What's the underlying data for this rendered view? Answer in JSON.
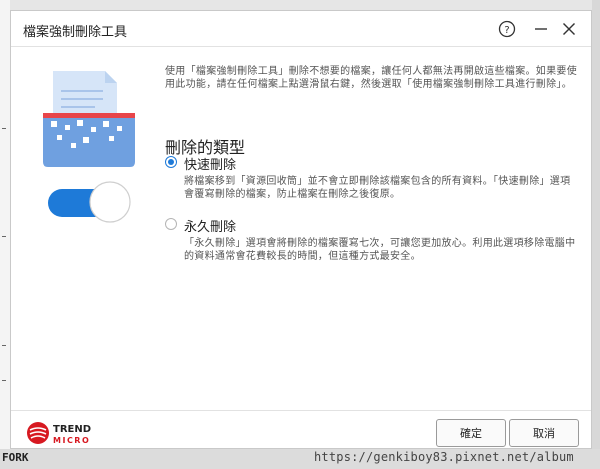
{
  "dialog": {
    "title": "檔案強制刪除工具",
    "help_icon": "help-circle-icon",
    "minimize_icon": "minimize-icon",
    "close_icon": "close-icon"
  },
  "intro_text": "使用「檔案強制刪除工具」刪除不想要的檔案，讓任何人都無法再開啟這些檔案。如果要使用此功能，請在任何檔案上點選滑鼠右鍵，然後選取「使用檔案強制刪除工具進行刪除」。",
  "deletion_types": {
    "title": "刪除的類型",
    "options": [
      {
        "label": "快速刪除",
        "description": "將檔案移到「資源回收筒」並不會立即刪除該檔案包含的所有資料。「快速刪除」選項會覆寫刪除的檔案，防止檔案在刪除之後復原。",
        "selected": true
      },
      {
        "label": "永久刪除",
        "description": "「永久刪除」選項會將刪除的檔案覆寫七次，可讓您更加放心。利用此選項移除電腦中的資料通常會花費較長的時間，但這種方式最安全。",
        "selected": false
      }
    ]
  },
  "toggle": {
    "state": "on"
  },
  "footer": {
    "logo_text_line1": "TREND",
    "logo_text_line2": "MICRO",
    "ok_label": "確定",
    "cancel_label": "取消"
  },
  "watermark": "https://genkiboy83.pixnet.net/album",
  "background_fragment": "FORK",
  "colors": {
    "accent": "#1e7ad8",
    "shredder_blue": "#6fa0e0",
    "shredder_red": "#e8454a",
    "logo_red": "#d71921"
  }
}
